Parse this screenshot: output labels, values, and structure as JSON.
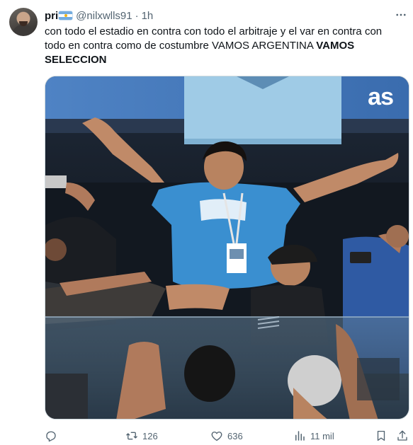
{
  "tweet": {
    "display_name": "pri",
    "handle": "@nilxwlls91",
    "separator": "·",
    "time": "1h",
    "text_regular": "con todo el estadio en contra con todo el arbitraje y el var en contra con todo en contra como de costumbre VAMOS ARGENTINA ",
    "text_bold": "VAMOS SELECCION",
    "media_watermark": "as"
  },
  "actions": {
    "replies": "",
    "retweets": "126",
    "likes": "636",
    "views": "11 mil"
  },
  "icons": {
    "flag": "argentina-flag-emoji",
    "more": "more-icon",
    "reply": "reply-icon",
    "retweet": "retweet-icon",
    "like": "heart-icon",
    "views": "views-icon",
    "bookmark": "bookmark-icon",
    "share": "share-icon"
  },
  "colors": {
    "text": "#0f1419",
    "secondary": "#536471",
    "flag_blue": "#74acdf"
  }
}
